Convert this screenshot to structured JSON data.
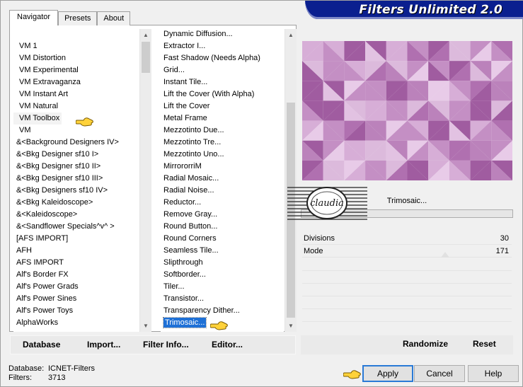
{
  "header": {
    "title": "Filters Unlimited 2.0"
  },
  "tabs": [
    {
      "label": "Navigator"
    },
    {
      "label": "Presets"
    },
    {
      "label": "About"
    }
  ],
  "categories": [
    "VM 1",
    "VM Distortion",
    "VM Experimental",
    "VM Extravaganza",
    "VM Instant Art",
    "VM Natural",
    "VM Toolbox",
    "VM",
    "&<Background Designers IV>",
    "&<Bkg Designer sf10 I>",
    "&<Bkg Designer sf10 II>",
    "&<Bkg Designer sf10 III>",
    "&<Bkg Designers sf10 IV>",
    "&<Bkg Kaleidoscope>",
    "&<Kaleidoscope>",
    "&<Sandflower Specials^v^ >",
    "[AFS IMPORT]",
    "AFH",
    "AFS IMPORT",
    "Alf's Border FX",
    "Alf's Power Grads",
    "Alf's Power Sines",
    "Alf's Power Toys",
    "AlphaWorks"
  ],
  "filters": [
    "Dynamic Diffusion...",
    "Extractor I...",
    "Fast Shadow (Needs Alpha)",
    "Grid...",
    "Instant Tile...",
    "Lift the Cover (With Alpha)",
    "Lift the Cover",
    "Metal Frame",
    "Mezzotinto Due...",
    "Mezzotinto Tre...",
    "Mezzotinto Uno...",
    "MirrororriM",
    "Radial Mosaic...",
    "Radial Noise...",
    "Reductor...",
    "Remove Gray...",
    "Round Button...",
    "Round Corners",
    "Seamless Tile...",
    "Slipthrough",
    "Softborder...",
    "Tiler...",
    "Transistor...",
    "Transparency Dither...",
    "Trimosaic..."
  ],
  "selected_category": "VM Toolbox",
  "selected_filter": "Trimosaic...",
  "filter_panel": {
    "name": "Trimosaic..."
  },
  "params": [
    {
      "name": "Divisions",
      "value": "30"
    },
    {
      "name": "Mode",
      "value": "171"
    }
  ],
  "watermark": {
    "text": "claudia"
  },
  "toolbar": {
    "database": "Database",
    "import": "Import...",
    "filter_info": "Filter Info...",
    "editor": "Editor...",
    "randomize": "Randomize",
    "reset": "Reset"
  },
  "status": {
    "database_label": "Database:",
    "database_value": "ICNET-Filters",
    "filters_label": "Filters:",
    "filters_value": "3713"
  },
  "buttons": {
    "apply": "Apply",
    "cancel": "Cancel",
    "help": "Help"
  },
  "colors": {
    "banner": "#0a1f8f",
    "preview_light": "#e6c6e6",
    "preview_dark": "#a0549c",
    "selection": "#1e70d6"
  }
}
